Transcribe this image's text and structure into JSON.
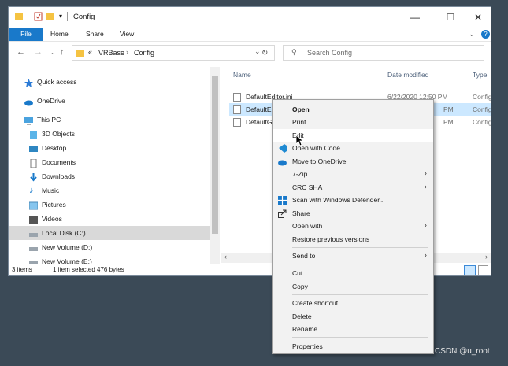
{
  "window": {
    "title": "Config",
    "controls": {
      "minimize": "—",
      "maximize": "☐",
      "close": "✕"
    }
  },
  "ribbon": {
    "tabs": [
      "File",
      "Home",
      "Share",
      "View"
    ]
  },
  "address": {
    "overflow": "«",
    "crumbs": [
      "VRBase",
      "Config"
    ],
    "search_placeholder": "Search Config"
  },
  "nav_pane": {
    "items": [
      {
        "label": "Quick access",
        "icon": "star-icon"
      },
      {
        "label": "OneDrive",
        "icon": "cloud-icon"
      },
      {
        "label": "This PC",
        "icon": "computer-icon"
      },
      {
        "label": "3D Objects",
        "icon": "cube-icon"
      },
      {
        "label": "Desktop",
        "icon": "desktop-icon"
      },
      {
        "label": "Documents",
        "icon": "document-icon"
      },
      {
        "label": "Downloads",
        "icon": "download-icon"
      },
      {
        "label": "Music",
        "icon": "music-icon"
      },
      {
        "label": "Pictures",
        "icon": "picture-icon"
      },
      {
        "label": "Videos",
        "icon": "video-icon"
      },
      {
        "label": "Local Disk (C:)",
        "icon": "drive-icon",
        "selected": true
      },
      {
        "label": "New Volume (D:)",
        "icon": "drive-icon"
      },
      {
        "label": "New Volume (E:)",
        "icon": "drive-icon"
      }
    ]
  },
  "file_list": {
    "columns": [
      "Name",
      "Date modified",
      "Type"
    ],
    "files": [
      {
        "name": "DefaultEditor.ini",
        "date": "6/22/2020 12:50 PM",
        "type": "Config"
      },
      {
        "name": "DefaultE",
        "date": "PM",
        "type": "Config",
        "selected": true
      },
      {
        "name": "DefaultG",
        "date": "PM",
        "type": "Config"
      }
    ]
  },
  "status": {
    "count": "3 items",
    "selection": "1 item selected  476 bytes"
  },
  "context_menu": {
    "items": [
      {
        "label": "Open",
        "bold": true
      },
      {
        "label": "Print"
      },
      {
        "label": "Edit",
        "hover": true
      },
      {
        "label": "Open with Code",
        "icon": "vscode-icon"
      },
      {
        "label": "Move to OneDrive",
        "icon": "onedrive-icon"
      },
      {
        "label": "7-Zip",
        "submenu": true
      },
      {
        "label": "CRC SHA",
        "submenu": true
      },
      {
        "label": "Scan with Windows Defender...",
        "icon": "defender-icon"
      },
      {
        "label": "Share",
        "icon": "share-icon"
      },
      {
        "label": "Open with",
        "submenu": true
      },
      {
        "label": "Restore previous versions"
      },
      {
        "label": "Send to",
        "submenu": true
      },
      {
        "label": "Cut"
      },
      {
        "label": "Copy"
      },
      {
        "label": "Create shortcut"
      },
      {
        "label": "Delete"
      },
      {
        "label": "Rename"
      },
      {
        "label": "Properties"
      }
    ]
  },
  "watermark": "CSDN @u_root",
  "colors": {
    "accent": "#1979ca",
    "selection": "#cce8ff",
    "background": "#3b4a57"
  }
}
